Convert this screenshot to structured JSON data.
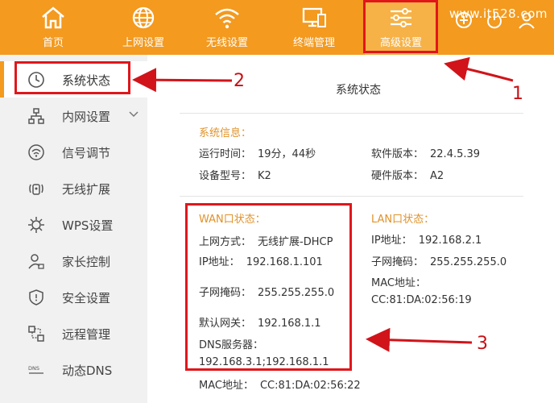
{
  "brand": "www.it528.com",
  "colors": {
    "nav_bg": "#f39a1f",
    "nav_active": "#f6b247",
    "accent_text": "#e0922a",
    "annotation_red": "#e0161b"
  },
  "topnav": {
    "items": [
      {
        "label": "首页",
        "icon": "home-icon"
      },
      {
        "label": "上网设置",
        "icon": "globe-icon"
      },
      {
        "label": "无线设置",
        "icon": "wifi-icon"
      },
      {
        "label": "终端管理",
        "icon": "devices-icon"
      },
      {
        "label": "高级设置",
        "icon": "sliders-icon",
        "active": true
      }
    ],
    "right_icons": [
      "add-icon",
      "power-icon",
      "user-icon"
    ]
  },
  "sidebar": {
    "items": [
      {
        "label": "系统状态",
        "icon": "clock-icon",
        "active": true
      },
      {
        "label": "内网设置",
        "icon": "network-icon",
        "expandable": true
      },
      {
        "label": "信号调节",
        "icon": "signal-icon"
      },
      {
        "label": "无线扩展",
        "icon": "repeater-icon"
      },
      {
        "label": "WPS设置",
        "icon": "wps-gear-icon"
      },
      {
        "label": "家长控制",
        "icon": "parent-control-icon"
      },
      {
        "label": "安全设置",
        "icon": "shield-icon"
      },
      {
        "label": "远程管理",
        "icon": "remote-icon"
      },
      {
        "label": "动态DNS",
        "icon": "dns-icon"
      }
    ]
  },
  "main": {
    "title": "系统状态",
    "system_info": {
      "heading": "系统信息：",
      "uptime_label": "运行时间：",
      "uptime_value": "19分，44秒",
      "model_label": "设备型号：",
      "model_value": "K2",
      "sw_label": "软件版本：",
      "sw_value": "22.4.5.39",
      "hw_label": "硬件版本：",
      "hw_value": "A2"
    },
    "wan": {
      "heading": "WAN口状态：",
      "mode_label": "上网方式：",
      "mode_value": "无线扩展-DHCP",
      "ip_label": "IP地址：",
      "ip_value": "192.168.1.101",
      "mask_label": "子网掩码：",
      "mask_value": "255.255.255.0",
      "gw_label": "默认网关：",
      "gw_value": "192.168.1.1",
      "dns_label": "DNS服务器：",
      "dns_value": "192.168.3.1;192.168.1.1",
      "mac_label": "MAC地址：",
      "mac_value": "CC:81:DA:02:56:22"
    },
    "lan": {
      "heading": "LAN口状态：",
      "ip_label": "IP地址：",
      "ip_value": "192.168.2.1",
      "mask_label": "子网掩码：",
      "mask_value": "255.255.255.0",
      "mac_label": "MAC地址：",
      "mac_value": "CC:81:DA:02:56:19"
    }
  },
  "annotations": [
    "1",
    "2",
    "3"
  ]
}
